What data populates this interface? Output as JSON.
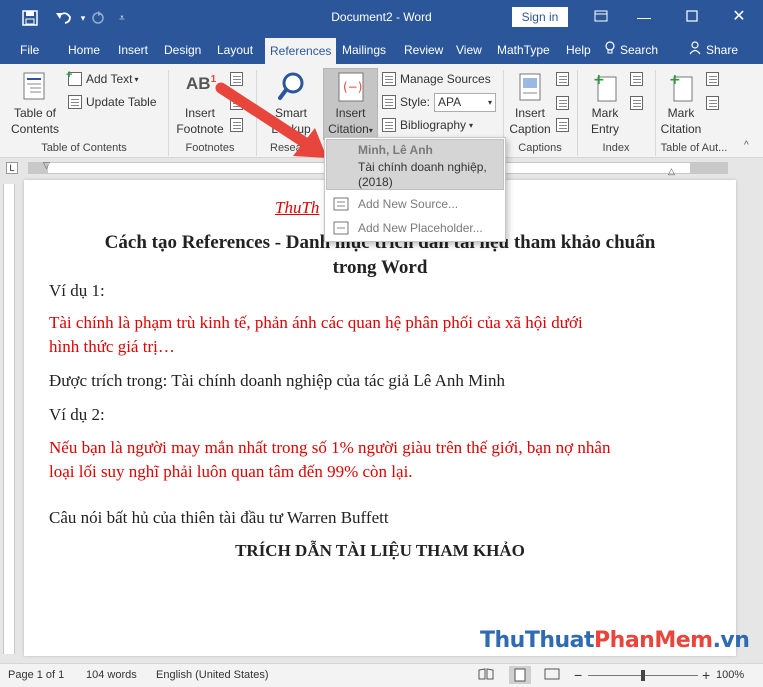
{
  "titlebar": {
    "title": "Document2 - Word",
    "sign_in": "Sign in"
  },
  "tabs": [
    "File",
    "Home",
    "Insert",
    "Design",
    "Layout",
    "References",
    "Mailings",
    "Review",
    "View",
    "MathType",
    "Help",
    "Search",
    "Share"
  ],
  "ribbon": {
    "toc": {
      "table_of_contents_line1": "Table of",
      "table_of_contents_line2": "Contents",
      "add_text": "Add Text",
      "update_table": "Update Table",
      "group_label": "Table of Contents"
    },
    "footnotes": {
      "insert_footnote_line1": "Insert",
      "insert_footnote_line2": "Footnote",
      "group_label": "Footnotes"
    },
    "research": {
      "smart_line1": "Smart",
      "smart_line2": "Lookup",
      "group_label": "Resea"
    },
    "citations": {
      "insert_citation_line1": "Insert",
      "insert_citation_line2": "Citation",
      "manage_sources": "Manage Sources",
      "style_label": "Style:",
      "style_value": "APA",
      "bibliography": "Bibliography"
    },
    "captions": {
      "insert_caption_line1": "Insert",
      "insert_caption_line2": "Caption",
      "group_label": "Captions"
    },
    "index": {
      "mark_entry_line1": "Mark",
      "mark_entry_line2": "Entry",
      "group_label": "Index"
    },
    "toa": {
      "mark_citation_line1": "Mark",
      "mark_citation_line2": "Citation",
      "group_label": "Table of Aut..."
    }
  },
  "dropdown": {
    "source_author": "Minh, Lê  Anh",
    "source_title": "Tài chính doanh nghiệp,",
    "source_year": "(2018)",
    "add_new_source": "Add New Source...",
    "add_new_placeholder": "Add New Placeholder..."
  },
  "document": {
    "header_fragment": "ThuTh",
    "heading_line1": "Cách tạo References - Danh mục trích dẫn tài liệu tham khảo chuẩn",
    "heading_line2": "trong Word",
    "vidu1": "Ví dụ 1:",
    "quote1_line1": "Tài chính là phạm trù kinh tế, phản ánh các quan hệ phân phối của xã hội dưới",
    "quote1_line2": "hình thức giá trị…",
    "cited1": "Được trích trong: Tài chính doanh nghiệp của tác giả Lê Anh Minh",
    "vidu2": "Ví dụ 2:",
    "quote2_line1": "Nếu bạn là người may mắn nhất trong số 1% người giàu trên thế giới, bạn nợ nhân",
    "quote2_line2": "loại lối suy nghĩ phải luôn quan tâm đến 99% còn lại.",
    "cited2": "Câu nói bất hủ của thiên tài đầu tư Warren Buffett",
    "bibliography_heading": "TRÍCH DẪN TÀI LIỆU THAM KHẢO"
  },
  "statusbar": {
    "page": "Page 1 of 1",
    "words": "104 words",
    "language": "English (United States)",
    "zoom": "100%"
  },
  "watermark": {
    "part1": "ThuThuat",
    "part2": "PhanMem",
    "part3": ".vn"
  },
  "colors": {
    "word_blue": "#2b579a",
    "document_red": "#e00000",
    "arrow_red": "#e8453c"
  }
}
